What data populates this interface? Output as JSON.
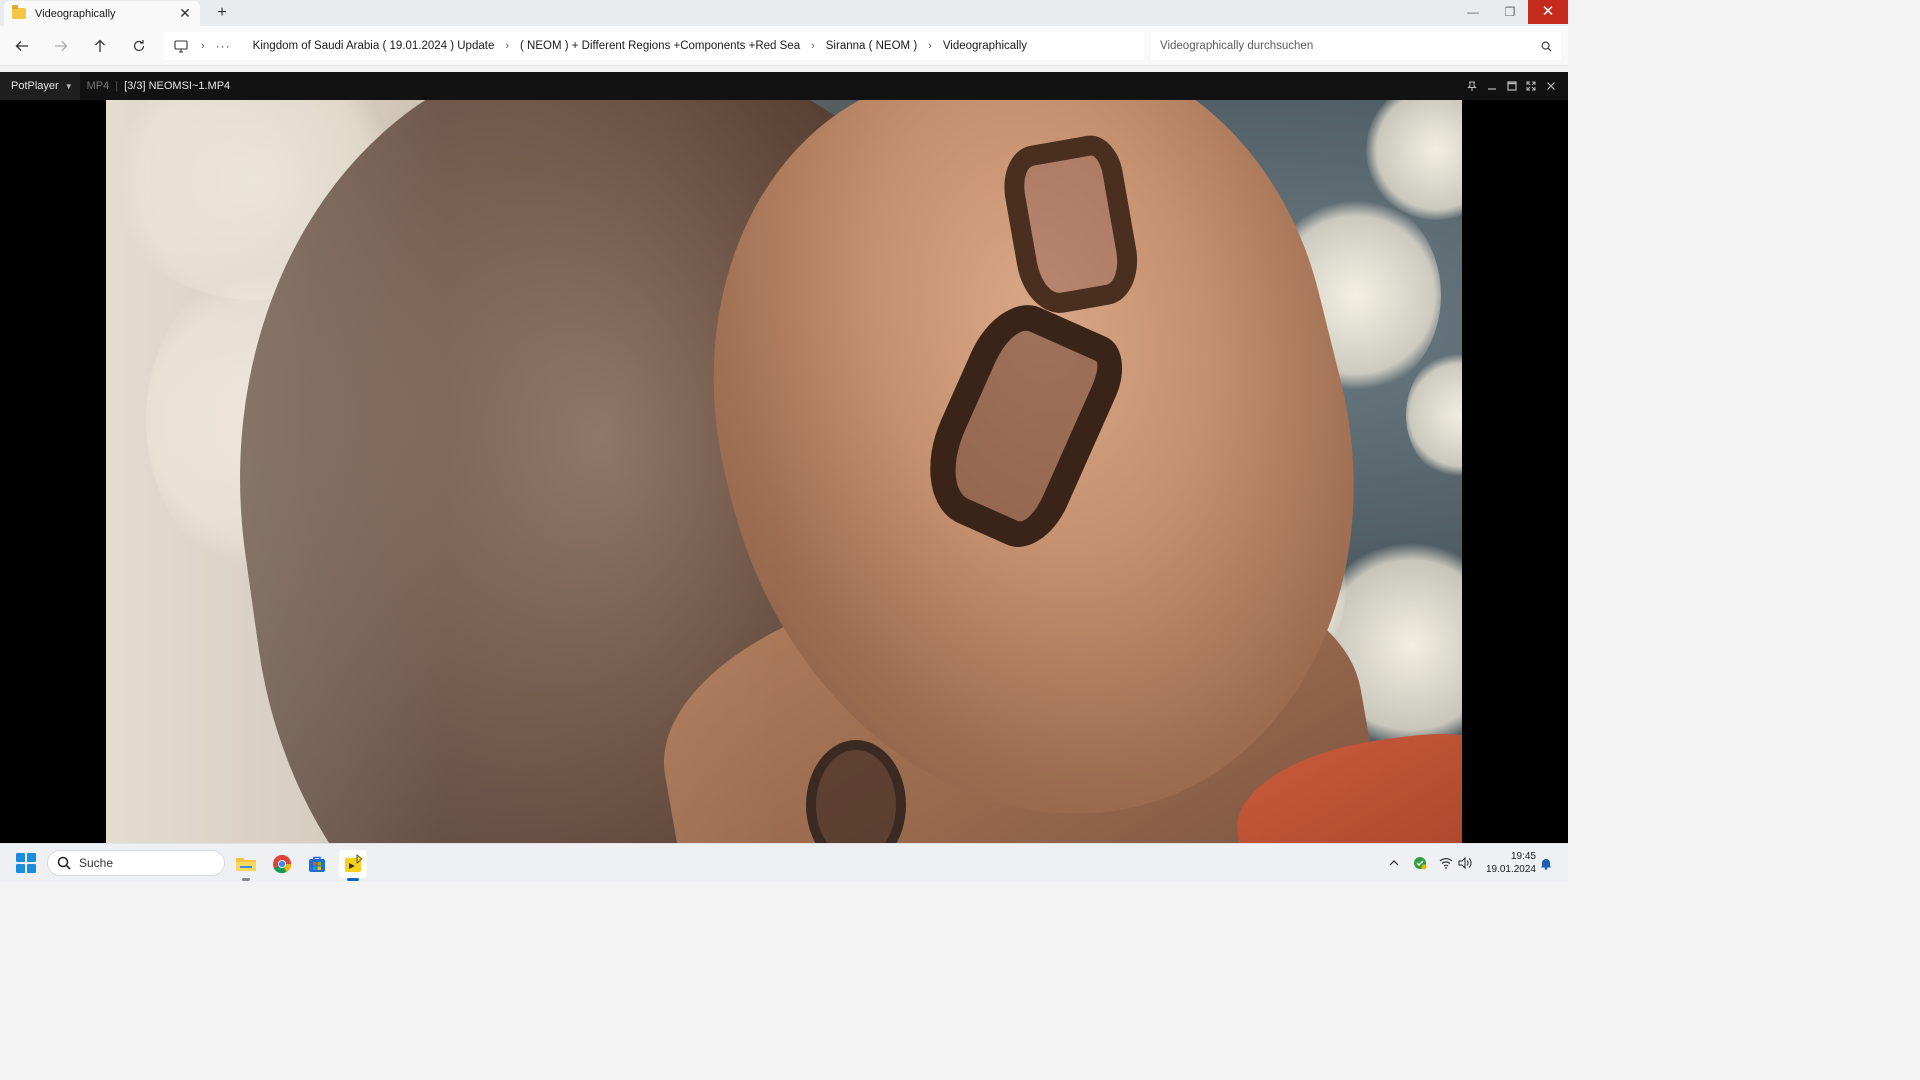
{
  "explorer": {
    "tab_title": "Videographically",
    "breadcrumbs": [
      "Kingdom of Saudi Arabia ( 19.01.2024 ) Update",
      "( NEOM ) + Different Regions +Components +Red Sea",
      "Siranna ( NEOM )",
      "Videographically"
    ],
    "overflow_label": "···",
    "search_placeholder": "Videographically durchsuchen"
  },
  "player": {
    "brand": "PotPlayer",
    "format": "MP4",
    "file": "[3/3] NEOMSI~1.MP4"
  },
  "taskbar": {
    "search_label": "Suche",
    "apps": [
      "file-explorer",
      "chrome",
      "microsoft-store",
      "potplayer"
    ],
    "time": "19:45",
    "date": "19.01.2024"
  },
  "colors": {
    "accent": "#0067c0",
    "close_red": "#c42b1c",
    "start_blue": "#1a8de0"
  }
}
